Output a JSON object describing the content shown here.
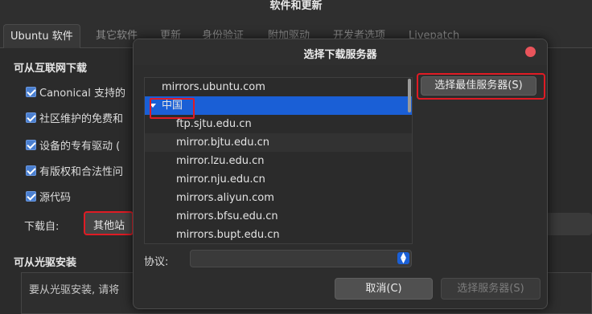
{
  "window": {
    "title": "软件和更新"
  },
  "tabs": [
    {
      "label": "Ubuntu 软件"
    },
    {
      "label": "其它软件"
    },
    {
      "label": "更新"
    },
    {
      "label": "身份验证"
    },
    {
      "label": "附加驱动"
    },
    {
      "label": "开发者选项"
    },
    {
      "label": "Livepatch"
    }
  ],
  "internet": {
    "section_title": "可从互联网下载",
    "checks": [
      {
        "label": "Canonical 支持的",
        "checked": true
      },
      {
        "label": "社区维护的免费和",
        "checked": true
      },
      {
        "label": "设备的专有驱动 (",
        "checked": true
      },
      {
        "label": "有版权和合法性问",
        "checked": true
      },
      {
        "label": "源代码",
        "checked": true
      }
    ],
    "download_from_label": "下载自:",
    "download_from_value": "其他站"
  },
  "cdrom": {
    "section_title": "可从光驱安装",
    "text": "要从光驱安装, 请将"
  },
  "dialog": {
    "title": "选择下载服务器",
    "best_button": "选择最佳服务器(S)",
    "servers": [
      {
        "label": "mirrors.ubuntu.com",
        "level": 0
      },
      {
        "label": "中国",
        "level": 0,
        "expanded": true,
        "selected": true
      },
      {
        "label": "ftp.sjtu.edu.cn",
        "level": 1
      },
      {
        "label": "mirror.bjtu.edu.cn",
        "level": 1
      },
      {
        "label": "mirror.lzu.edu.cn",
        "level": 1
      },
      {
        "label": "mirror.nju.edu.cn",
        "level": 1
      },
      {
        "label": "mirrors.aliyun.com",
        "level": 1
      },
      {
        "label": "mirrors.bfsu.edu.cn",
        "level": 1
      },
      {
        "label": "mirrors.bupt.edu.cn",
        "level": 1
      }
    ],
    "protocol_label": "协议:",
    "protocol_value": "",
    "cancel_button": "取消(C)",
    "select_button": "选择服务器(S)",
    "select_button_enabled": false
  },
  "colors": {
    "selection": "#1a5fd6",
    "highlight_box": "#e01b24",
    "close_button": "#e9545b",
    "checkbox": "#4a7fd0"
  }
}
